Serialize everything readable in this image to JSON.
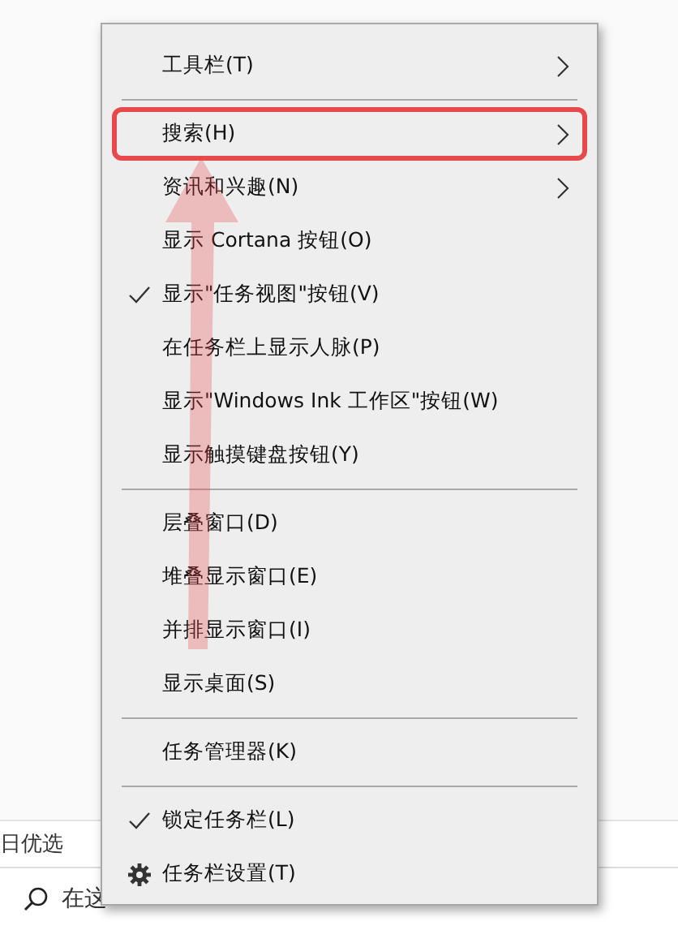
{
  "page": {
    "tab_text": "日优选",
    "search": {
      "placeholder": "在这"
    }
  },
  "context_menu": {
    "items": [
      {
        "kind": "item",
        "label": "工具栏(T)",
        "submenu": true,
        "checked": false,
        "highlighted": false
      },
      {
        "kind": "divider"
      },
      {
        "kind": "item",
        "label": "搜索(H)",
        "submenu": true,
        "checked": false,
        "highlighted": true
      },
      {
        "kind": "item",
        "label": "资讯和兴趣(N)",
        "submenu": true,
        "checked": false,
        "highlighted": false
      },
      {
        "kind": "item",
        "label": "显示 Cortana 按钮(O)",
        "submenu": false,
        "checked": false,
        "highlighted": false
      },
      {
        "kind": "item",
        "label": "显示\"任务视图\"按钮(V)",
        "submenu": false,
        "checked": true,
        "highlighted": false
      },
      {
        "kind": "item",
        "label": "在任务栏上显示人脉(P)",
        "submenu": false,
        "checked": false,
        "highlighted": false
      },
      {
        "kind": "item",
        "label": "显示\"Windows Ink 工作区\"按钮(W)",
        "submenu": false,
        "checked": false,
        "highlighted": false
      },
      {
        "kind": "item",
        "label": "显示触摸键盘按钮(Y)",
        "submenu": false,
        "checked": false,
        "highlighted": false
      },
      {
        "kind": "divider"
      },
      {
        "kind": "item",
        "label": "层叠窗口(D)",
        "submenu": false,
        "checked": false,
        "highlighted": false
      },
      {
        "kind": "item",
        "label": "堆叠显示窗口(E)",
        "submenu": false,
        "checked": false,
        "highlighted": false
      },
      {
        "kind": "item",
        "label": "并排显示窗口(I)",
        "submenu": false,
        "checked": false,
        "highlighted": false
      },
      {
        "kind": "item",
        "label": "显示桌面(S)",
        "submenu": false,
        "checked": false,
        "highlighted": false
      },
      {
        "kind": "divider"
      },
      {
        "kind": "item",
        "label": "任务管理器(K)",
        "submenu": false,
        "checked": false,
        "highlighted": false
      },
      {
        "kind": "divider"
      },
      {
        "kind": "item",
        "label": "锁定任务栏(L)",
        "submenu": false,
        "checked": true,
        "highlighted": false
      },
      {
        "kind": "settings",
        "label": "任务栏设置(T)",
        "submenu": false,
        "checked": false,
        "highlighted": false
      }
    ]
  }
}
